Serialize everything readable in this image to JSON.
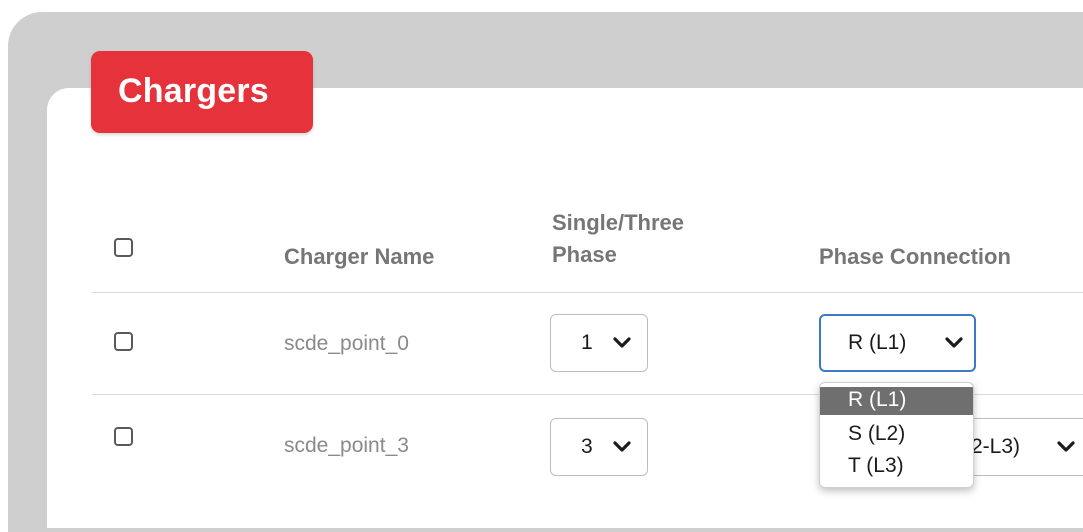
{
  "card": {
    "title": "Chargers",
    "accent_color": "#e5323b"
  },
  "table": {
    "headers": {
      "charger_name": "Charger Name",
      "phase_line1": "Single/Three",
      "phase_line2": "Phase",
      "phase_connection": "Phase Connection"
    },
    "rows": [
      {
        "name": "scde_point_0",
        "phase": "1",
        "connection": "R (L1)"
      },
      {
        "name": "scde_point_3",
        "phase": "3",
        "connection": "2-L3)"
      }
    ]
  },
  "dropdown": {
    "options": [
      "R (L1)",
      "S (L2)",
      "T (L3)"
    ],
    "selected": "R (L1)"
  },
  "icons": {
    "select_arrow": "chevron-down-icon"
  }
}
